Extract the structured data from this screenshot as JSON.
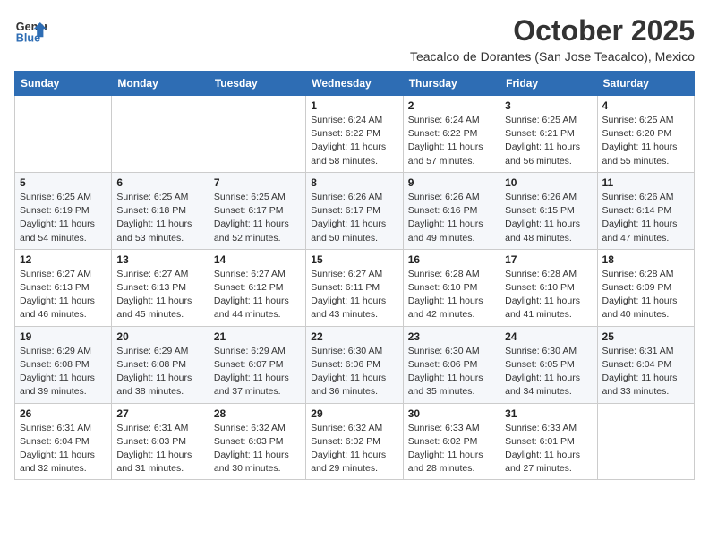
{
  "header": {
    "logo_general": "General",
    "logo_blue": "Blue",
    "month_title": "October 2025",
    "subtitle": "Teacalco de Dorantes (San Jose Teacalco), Mexico"
  },
  "weekdays": [
    "Sunday",
    "Monday",
    "Tuesday",
    "Wednesday",
    "Thursday",
    "Friday",
    "Saturday"
  ],
  "weeks": [
    [
      {
        "day": "",
        "sunrise": "",
        "sunset": "",
        "daylight": ""
      },
      {
        "day": "",
        "sunrise": "",
        "sunset": "",
        "daylight": ""
      },
      {
        "day": "",
        "sunrise": "",
        "sunset": "",
        "daylight": ""
      },
      {
        "day": "1",
        "sunrise": "Sunrise: 6:24 AM",
        "sunset": "Sunset: 6:22 PM",
        "daylight": "Daylight: 11 hours and 58 minutes."
      },
      {
        "day": "2",
        "sunrise": "Sunrise: 6:24 AM",
        "sunset": "Sunset: 6:22 PM",
        "daylight": "Daylight: 11 hours and 57 minutes."
      },
      {
        "day": "3",
        "sunrise": "Sunrise: 6:25 AM",
        "sunset": "Sunset: 6:21 PM",
        "daylight": "Daylight: 11 hours and 56 minutes."
      },
      {
        "day": "4",
        "sunrise": "Sunrise: 6:25 AM",
        "sunset": "Sunset: 6:20 PM",
        "daylight": "Daylight: 11 hours and 55 minutes."
      }
    ],
    [
      {
        "day": "5",
        "sunrise": "Sunrise: 6:25 AM",
        "sunset": "Sunset: 6:19 PM",
        "daylight": "Daylight: 11 hours and 54 minutes."
      },
      {
        "day": "6",
        "sunrise": "Sunrise: 6:25 AM",
        "sunset": "Sunset: 6:18 PM",
        "daylight": "Daylight: 11 hours and 53 minutes."
      },
      {
        "day": "7",
        "sunrise": "Sunrise: 6:25 AM",
        "sunset": "Sunset: 6:17 PM",
        "daylight": "Daylight: 11 hours and 52 minutes."
      },
      {
        "day": "8",
        "sunrise": "Sunrise: 6:26 AM",
        "sunset": "Sunset: 6:17 PM",
        "daylight": "Daylight: 11 hours and 50 minutes."
      },
      {
        "day": "9",
        "sunrise": "Sunrise: 6:26 AM",
        "sunset": "Sunset: 6:16 PM",
        "daylight": "Daylight: 11 hours and 49 minutes."
      },
      {
        "day": "10",
        "sunrise": "Sunrise: 6:26 AM",
        "sunset": "Sunset: 6:15 PM",
        "daylight": "Daylight: 11 hours and 48 minutes."
      },
      {
        "day": "11",
        "sunrise": "Sunrise: 6:26 AM",
        "sunset": "Sunset: 6:14 PM",
        "daylight": "Daylight: 11 hours and 47 minutes."
      }
    ],
    [
      {
        "day": "12",
        "sunrise": "Sunrise: 6:27 AM",
        "sunset": "Sunset: 6:13 PM",
        "daylight": "Daylight: 11 hours and 46 minutes."
      },
      {
        "day": "13",
        "sunrise": "Sunrise: 6:27 AM",
        "sunset": "Sunset: 6:13 PM",
        "daylight": "Daylight: 11 hours and 45 minutes."
      },
      {
        "day": "14",
        "sunrise": "Sunrise: 6:27 AM",
        "sunset": "Sunset: 6:12 PM",
        "daylight": "Daylight: 11 hours and 44 minutes."
      },
      {
        "day": "15",
        "sunrise": "Sunrise: 6:27 AM",
        "sunset": "Sunset: 6:11 PM",
        "daylight": "Daylight: 11 hours and 43 minutes."
      },
      {
        "day": "16",
        "sunrise": "Sunrise: 6:28 AM",
        "sunset": "Sunset: 6:10 PM",
        "daylight": "Daylight: 11 hours and 42 minutes."
      },
      {
        "day": "17",
        "sunrise": "Sunrise: 6:28 AM",
        "sunset": "Sunset: 6:10 PM",
        "daylight": "Daylight: 11 hours and 41 minutes."
      },
      {
        "day": "18",
        "sunrise": "Sunrise: 6:28 AM",
        "sunset": "Sunset: 6:09 PM",
        "daylight": "Daylight: 11 hours and 40 minutes."
      }
    ],
    [
      {
        "day": "19",
        "sunrise": "Sunrise: 6:29 AM",
        "sunset": "Sunset: 6:08 PM",
        "daylight": "Daylight: 11 hours and 39 minutes."
      },
      {
        "day": "20",
        "sunrise": "Sunrise: 6:29 AM",
        "sunset": "Sunset: 6:08 PM",
        "daylight": "Daylight: 11 hours and 38 minutes."
      },
      {
        "day": "21",
        "sunrise": "Sunrise: 6:29 AM",
        "sunset": "Sunset: 6:07 PM",
        "daylight": "Daylight: 11 hours and 37 minutes."
      },
      {
        "day": "22",
        "sunrise": "Sunrise: 6:30 AM",
        "sunset": "Sunset: 6:06 PM",
        "daylight": "Daylight: 11 hours and 36 minutes."
      },
      {
        "day": "23",
        "sunrise": "Sunrise: 6:30 AM",
        "sunset": "Sunset: 6:06 PM",
        "daylight": "Daylight: 11 hours and 35 minutes."
      },
      {
        "day": "24",
        "sunrise": "Sunrise: 6:30 AM",
        "sunset": "Sunset: 6:05 PM",
        "daylight": "Daylight: 11 hours and 34 minutes."
      },
      {
        "day": "25",
        "sunrise": "Sunrise: 6:31 AM",
        "sunset": "Sunset: 6:04 PM",
        "daylight": "Daylight: 11 hours and 33 minutes."
      }
    ],
    [
      {
        "day": "26",
        "sunrise": "Sunrise: 6:31 AM",
        "sunset": "Sunset: 6:04 PM",
        "daylight": "Daylight: 11 hours and 32 minutes."
      },
      {
        "day": "27",
        "sunrise": "Sunrise: 6:31 AM",
        "sunset": "Sunset: 6:03 PM",
        "daylight": "Daylight: 11 hours and 31 minutes."
      },
      {
        "day": "28",
        "sunrise": "Sunrise: 6:32 AM",
        "sunset": "Sunset: 6:03 PM",
        "daylight": "Daylight: 11 hours and 30 minutes."
      },
      {
        "day": "29",
        "sunrise": "Sunrise: 6:32 AM",
        "sunset": "Sunset: 6:02 PM",
        "daylight": "Daylight: 11 hours and 29 minutes."
      },
      {
        "day": "30",
        "sunrise": "Sunrise: 6:33 AM",
        "sunset": "Sunset: 6:02 PM",
        "daylight": "Daylight: 11 hours and 28 minutes."
      },
      {
        "day": "31",
        "sunrise": "Sunrise: 6:33 AM",
        "sunset": "Sunset: 6:01 PM",
        "daylight": "Daylight: 11 hours and 27 minutes."
      },
      {
        "day": "",
        "sunrise": "",
        "sunset": "",
        "daylight": ""
      }
    ]
  ]
}
